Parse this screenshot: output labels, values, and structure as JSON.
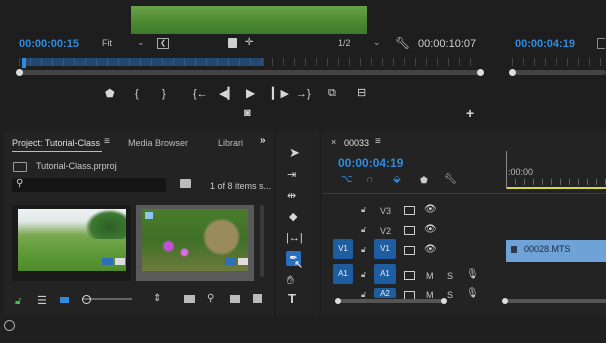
{
  "source_monitor": {
    "timecode": "00:00:00:15",
    "fit": "Fit",
    "resolution": "1/2",
    "duration": "00:00:10:07"
  },
  "program_monitor": {
    "timecode": "00:00:04:19"
  },
  "project_panel": {
    "tabs": [
      "Project: Tutorial-Class",
      "Media Browser",
      "Librari"
    ],
    "more": "»",
    "file_name": "Tutorial-Class.prproj",
    "item_count": "1 of 8 items s..."
  },
  "timeline": {
    "sequence_name": "00033",
    "timecode": "00:00:04:19",
    "ruler_label": ":00:00",
    "clip_name": "00028.MTS",
    "video_tracks": [
      "V3",
      "V2",
      "V1"
    ],
    "audio_tracks": [
      "A1",
      "A2"
    ],
    "v1_source": "V1",
    "a1_source": "A1",
    "mute": "M",
    "solo": "S"
  },
  "colors": {
    "accent_blue": "#2f8be0",
    "clip_blue": "#6fa3d8",
    "playhead_yellow": "#d9d93a"
  }
}
